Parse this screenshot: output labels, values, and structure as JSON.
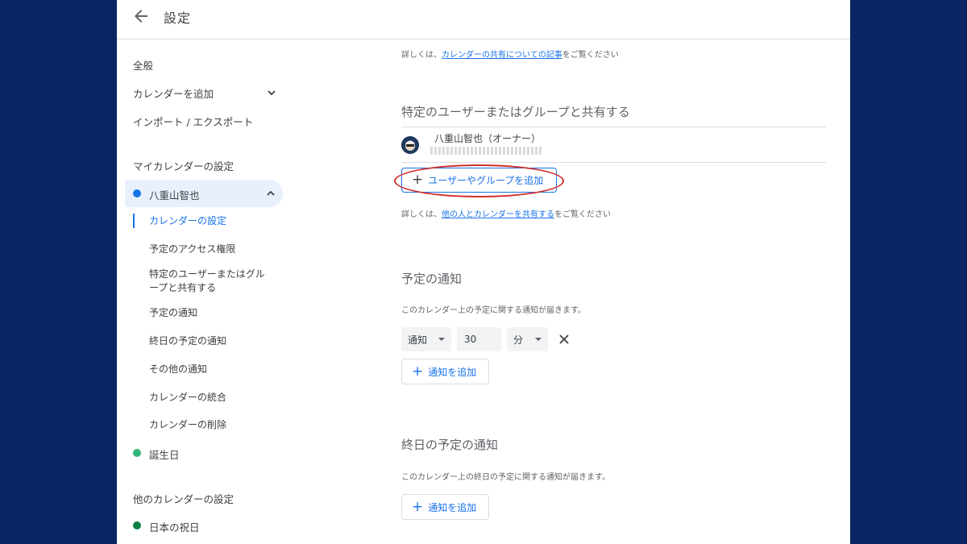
{
  "header": {
    "title": "設定"
  },
  "sidebar": {
    "general": "全般",
    "add_calendar": "カレンダーを追加",
    "import_export": "インポート / エクスポート",
    "my_calendars_heading": "マイカレンダーの設定",
    "my_calendar": {
      "name": "八重山智也",
      "color": "#1a73e8"
    },
    "sub_items": [
      "カレンダーの設定",
      "予定のアクセス権限",
      "特定のユーザーまたはグル",
      "ープと共有する",
      "予定の通知",
      "終日の予定の通知",
      "その他の通知",
      "カレンダーの統合",
      "カレンダーの削除"
    ],
    "birthdays": {
      "name": "誕生日",
      "color": "#33b679"
    },
    "other_calendars_heading": "他のカレンダーの設定",
    "holidays": {
      "name": "日本の祝日",
      "color": "#0b8043"
    }
  },
  "main": {
    "top_note": {
      "prefix": "詳しくは、",
      "link": "カレンダーの共有についての記事",
      "suffix": "をご覧ください"
    },
    "share_section": {
      "title": "特定のユーザーまたはグループと共有する",
      "owner": "八重山智也（オーナー）",
      "add_button": "ユーザーやグループを追加",
      "note": {
        "prefix": "詳しくは、",
        "link": "他の人とカレンダーを共有する",
        "suffix": "をご覧ください"
      }
    },
    "event_notifications": {
      "title": "予定の通知",
      "description": "このカレンダー上の予定に関する通知が届きます。",
      "method": "通知",
      "value": "30",
      "unit": "分",
      "remove_icon": "✕",
      "add_button": "通知を追加"
    },
    "allday_notifications": {
      "title": "終日の予定の通知",
      "description": "このカレンダー上の終日の予定に関する通知が届きます。",
      "add_button": "通知を追加"
    }
  }
}
